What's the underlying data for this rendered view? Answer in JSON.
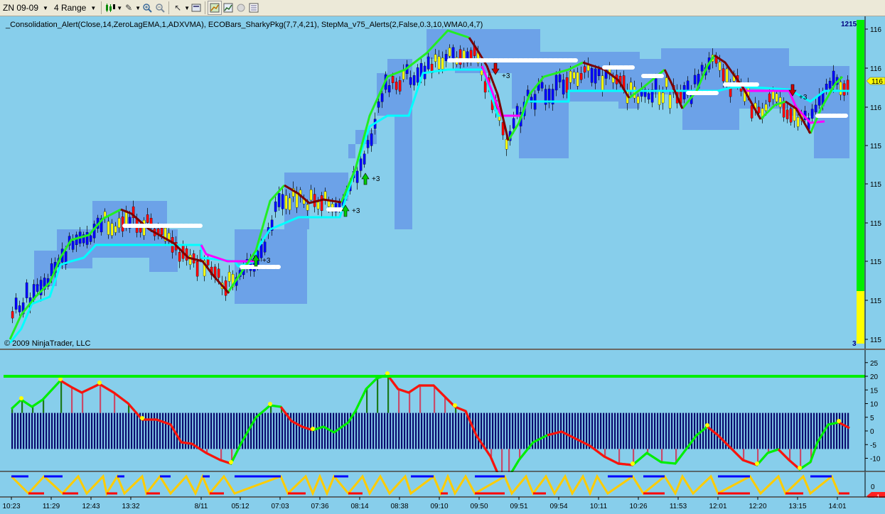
{
  "toolbar": {
    "instrument": "ZN 09-09",
    "period": "4 Range",
    "icons": [
      "candlestick-icon",
      "pencil-icon",
      "zoom-in-icon",
      "zoom-out-icon",
      "cursor-icon",
      "properties-icon",
      "strategy-icon",
      "chart-icon",
      "circle-icon",
      "data-box-icon"
    ]
  },
  "price_panel": {
    "indicator_text": "_Consolidation_Alert(Close,14,ZeroLagEMA,1,ADXVMA), ECOBars_SharkyPkg(7,7,4,21), StepMa_v75_Alerts(2,False,0.3,10,WMA0,4,7)",
    "copyright": "© 2009 NinjaTrader, LLC",
    "top_right_label": "1215",
    "bottom_right_label": "3",
    "current_price_label": "116",
    "price_axis_labels": [
      "116",
      "116",
      "116",
      "115",
      "115",
      "115",
      "115",
      "115",
      "115"
    ],
    "signals": [
      {
        "text": "+3",
        "dir": "up"
      },
      {
        "text": "+3",
        "dir": "up"
      },
      {
        "text": "+3",
        "dir": "up"
      },
      {
        "text": "+3",
        "dir": "down"
      },
      {
        "text": "+3",
        "dir": "down"
      }
    ]
  },
  "oscillator_panel": {
    "axis_labels": [
      "25",
      "20",
      "15",
      "10",
      "5",
      "0",
      "-5",
      "-10"
    ]
  },
  "bottom_panel": {
    "axis_label": "0",
    "marker_label": "-1"
  },
  "time_axis": [
    "10:23",
    "11:29",
    "12:43",
    "13:32",
    "8/11",
    "05:12",
    "07:03",
    "07:36",
    "08:14",
    "08:38",
    "09:10",
    "09:50",
    "09:51",
    "09:54",
    "10:11",
    "10:26",
    "11:53",
    "12:01",
    "12:20",
    "13:15",
    "14:01"
  ],
  "colors": {
    "background": "#87ceeb",
    "band": "#6a9fe8",
    "green_line": "#22ee22",
    "maroon_line": "#7a0000",
    "cyan_line": "#00ffff",
    "magenta_line": "#ff00ff",
    "bull_candle": "#0000ff",
    "bear_candle": "#ff0000",
    "neutral_candle": "#ffff00",
    "navy_bars": "#0a0a6e",
    "signal_bar_green": "#00ff00",
    "signal_bar_yellow": "#ffff00"
  }
}
